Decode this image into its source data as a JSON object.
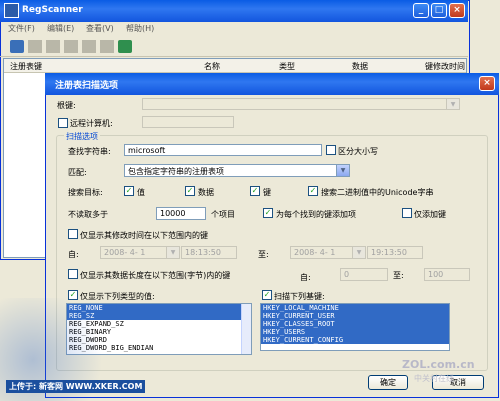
{
  "main": {
    "title": "RegScanner",
    "menu": [
      "文件(F)",
      "编辑(E)",
      "查看(V)",
      "帮助(H)"
    ],
    "columns": [
      "注册表键",
      "名称",
      "类型",
      "数据",
      "键修改时间"
    ]
  },
  "dialog": {
    "title": "注册表扫描选项",
    "root_label": "根键:",
    "remote_label": "远程计算机:",
    "scan_group": "扫描选项",
    "find_label": "查找字符串:",
    "find_value": "microsoft",
    "case_label": "区分大小写",
    "match_label": "匹配:",
    "match_value": "包含指定字符串的注册表项",
    "targets_label": "搜索目标:",
    "target_value": "值",
    "target_data": "数据",
    "target_key": "键",
    "target_unicode": "搜索二进制值中的Unicode字串",
    "limit_label": "不读取多于",
    "limit_value": "10000",
    "limit_unit": "个项目",
    "add_each": "为每个找到的键添加项",
    "only_add_key": "仅添加键",
    "time_range_label": "仅显示其修改时间在以下范围内的键",
    "from_label": "自:",
    "to_label": "至:",
    "date_from": "2008- 4- 1",
    "time_from": "18:13:50",
    "date_to": "2008- 4- 1",
    "time_to": "19:13:50",
    "length_label": "仅显示其数据长度在以下范围(字节)内的键",
    "len_from_label": "自:",
    "len_from": "0",
    "len_to_label": "至:",
    "len_to": "100",
    "types_label": "仅显示下列类型的值:",
    "types": [
      "REG_NONE",
      "REG_SZ",
      "REG_EXPAND_SZ",
      "REG_BINARY",
      "REG_DWORD",
      "REG_DWORD_BIG_ENDIAN"
    ],
    "basekeys_label": "扫描下列基键:",
    "basekeys": [
      "HKEY_LOCAL_MACHINE",
      "HKEY_CURRENT_USER",
      "HKEY_CLASSES_ROOT",
      "HKEY_USERS",
      "HKEY_CURRENT_CONFIG"
    ],
    "ok_label": "确定",
    "cancel_label": "取消"
  },
  "watermark": {
    "upload_text": "上传于: 新客网 WWW.XKER.COM",
    "zol_text": "ZOL.com.cn",
    "zol_sub": "中关村在线"
  },
  "colors": {
    "titlebar": "#0a5ce4",
    "selection": "#316ac5",
    "face": "#ece9d8"
  }
}
